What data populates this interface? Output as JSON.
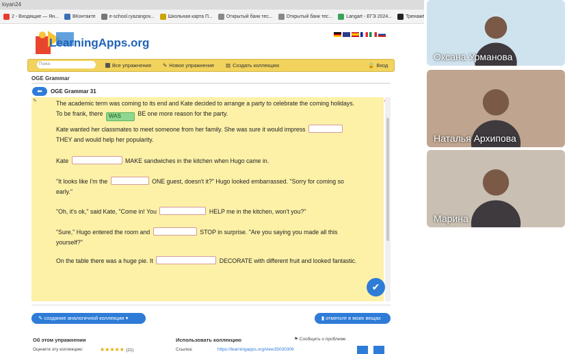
{
  "browser": {
    "address": "loyan24",
    "bookmarks": [
      {
        "label": "2 - Входящие — Ян...",
        "color": "#e83b2f"
      },
      {
        "label": "ВКонтакте",
        "color": "#3b6fb6"
      },
      {
        "label": "e-school.ryazangov...",
        "color": "#777777"
      },
      {
        "label": "Школьная карта П...",
        "color": "#caa500"
      },
      {
        "label": "Открытый банк тес...",
        "color": "#888888"
      },
      {
        "label": "Открытый банк тес...",
        "color": "#888888"
      },
      {
        "label": "Langart - ЕГЭ 2024...",
        "color": "#3aa35a"
      },
      {
        "label": "Тренажёр по гов",
        "color": "#222222"
      }
    ]
  },
  "site": {
    "logo": "LearningApps.org",
    "search_placeholder": "Поиск",
    "nav": {
      "all_exercises": "Все упражнения",
      "new_exercise": "Новое упражнение",
      "create_collection": "Создать коллекцию",
      "login": "Вход"
    }
  },
  "exercise": {
    "heading": "OGE Grammar",
    "title": "OGE Grammar 31",
    "paragraphs": [
      {
        "before": "The academic term was coming to its end and Kate decided to arrange a party to celebrate the coming holidays. To be frank, there",
        "answer": "WAS",
        "after": "BE one more reason for the party."
      },
      {
        "before": "Kate wanted her classmates to meet someone from her family. She was sure it would impress",
        "answer": "",
        "after": "THEY and would help her popularity."
      },
      {
        "before": "Kate",
        "answer": "",
        "after": "MAKE sandwiches in the kitchen when Hugo came in."
      },
      {
        "before": "\"It looks like I'm the",
        "answer": "",
        "after": "ONE guest, doesn't it?\" Hugo looked embarrassed. \"Sorry for coming so early.\""
      },
      {
        "before": "\"Oh, it's ok,\" said Kate, \"Come in! You",
        "answer": "",
        "after": "HELP me in the kitchen, won't you?\""
      },
      {
        "before": "\"Sure,\" Hugo entered the room and",
        "answer": "",
        "after": "STOP in surprise. \"Are you saying you made all this yourself?\""
      },
      {
        "before": "On the table there was a huge pie. It",
        "answer": "",
        "after": "DECORATE with different fruit and looked fantastic."
      }
    ]
  },
  "footer": {
    "create_similar": "создание аналогичной коллекции",
    "mark_in_my_things": "отметьте в моих вещах",
    "about": "Об этом упражнении",
    "use_collection": "Использовать коллекцию",
    "report": "Сообщить о проблеме",
    "rate": "Оцените эту коллекцию:",
    "rating_count": "(21)",
    "link_label": "Ссылка:",
    "link_value": "https://learningapps.org/view35030309"
  },
  "participants": [
    {
      "name": "Оксана Урманова",
      "bg": "#cfe3ef"
    },
    {
      "name": "Наталья Архипова",
      "bg": "#bfa58f"
    },
    {
      "name": "Марина",
      "bg": "#c9c0b3"
    }
  ]
}
